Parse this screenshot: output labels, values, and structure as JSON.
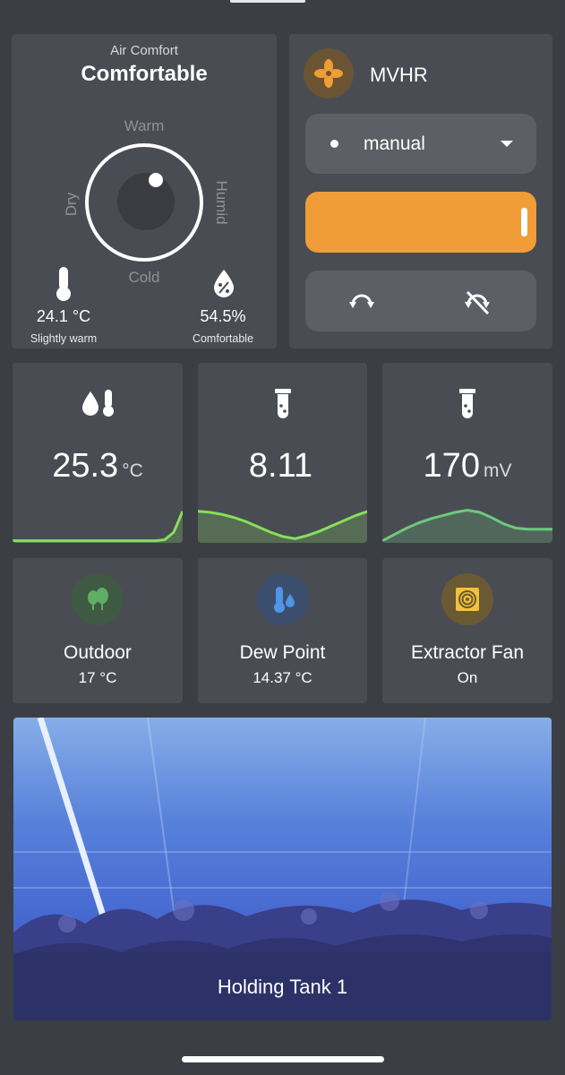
{
  "air_comfort": {
    "title": "Air Comfort",
    "state": "Comfortable",
    "dial_labels": {
      "top": "Warm",
      "bottom": "Cold",
      "left": "Dry",
      "right": "Humid"
    },
    "temperature": {
      "value": "24.1 °C",
      "status": "Slightly warm",
      "icon": "thermometer-icon"
    },
    "humidity": {
      "value": "54.5%",
      "status": "Comfortable",
      "icon": "humidity-drop-icon"
    }
  },
  "mvhr": {
    "title": "MVHR",
    "icon": "fan-icon",
    "mode": "manual",
    "speed_fraction": 1.0,
    "direction_buttons": [
      "rotate-icon",
      "no-rotate-icon"
    ],
    "colors": {
      "accent": "#f09c37",
      "badge": "#6a5433"
    }
  },
  "sensors": [
    {
      "value": "25.3",
      "unit": "°C",
      "icon": "water-temperature-icon",
      "spark": [
        2,
        2,
        2,
        2,
        2,
        2,
        2,
        2,
        2,
        2,
        2,
        2,
        2,
        2,
        2,
        2,
        2,
        3,
        10,
        30
      ]
    },
    {
      "value": "8.11",
      "unit": "",
      "icon": "test-tube-icon",
      "spark": [
        30,
        29,
        27,
        24,
        20,
        15,
        10,
        6,
        4,
        7,
        11,
        16,
        21,
        26,
        30
      ]
    },
    {
      "value": "170",
      "unit": "mV",
      "icon": "test-tube-icon",
      "spark": [
        2,
        8,
        14,
        19,
        23,
        26,
        29,
        31,
        29,
        24,
        18,
        14,
        13,
        13,
        13
      ]
    }
  ],
  "entities": [
    {
      "name": "Outdoor",
      "state": "17 °C",
      "icon": "tree-icon",
      "badge_color": "#3e5a43",
      "icon_color": "#5fae62"
    },
    {
      "name": "Dew Point",
      "state": "14.37 °C",
      "icon": "thermometer-water-icon",
      "badge_color": "#3c4e6e",
      "icon_color": "#4f95e8"
    },
    {
      "name": "Extractor Fan",
      "state": "On",
      "icon": "extractor-fan-icon",
      "badge_color": "#6a5a33",
      "icon_color": "#f3c23a"
    }
  ],
  "camera": {
    "label": "Holding Tank 1"
  }
}
